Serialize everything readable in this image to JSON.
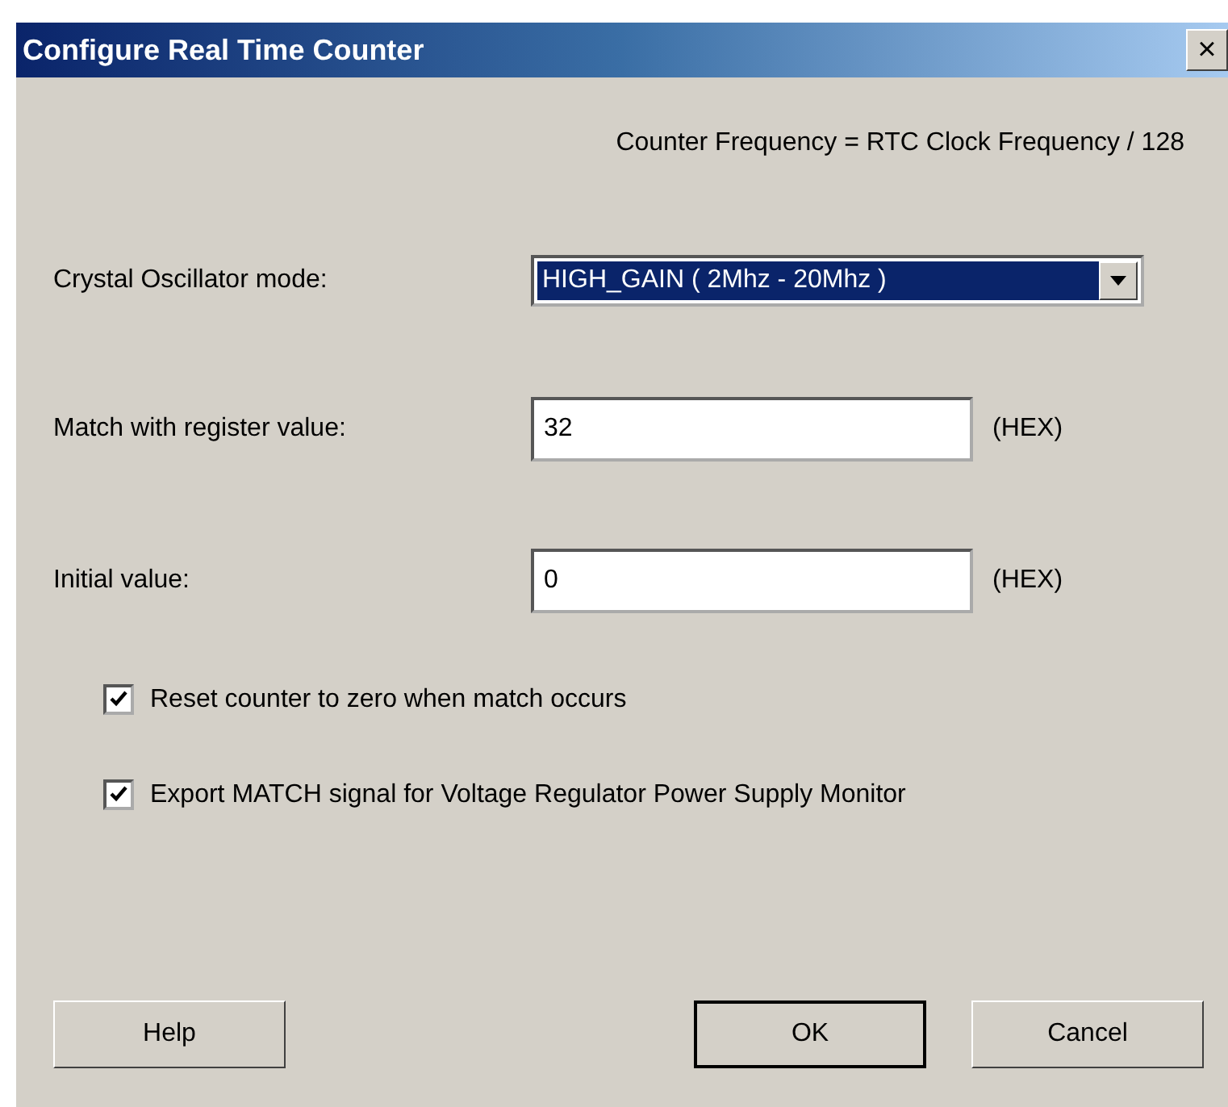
{
  "window": {
    "title": "Configure Real Time Counter",
    "close": "×"
  },
  "formula": "Counter Frequency = RTC Clock Frequency / 128",
  "fields": [
    {
      "kind": "dropdown",
      "label": "Crystal Oscillator mode:",
      "value": "HIGH_GAIN ( 2Mhz - 20Mhz )",
      "focused": true
    },
    {
      "kind": "text",
      "label": "Match with register value:",
      "value": "32",
      "unit": "(HEX)"
    },
    {
      "kind": "text",
      "label": "Initial value:",
      "value": "0",
      "unit": "(HEX)"
    }
  ],
  "checkboxes": [
    {
      "label": "Reset counter to zero when match occurs",
      "checked": true
    },
    {
      "label": "Export MATCH signal for Voltage Regulator Power Supply Monitor",
      "checked": true
    }
  ],
  "buttons": [
    {
      "label": "Help",
      "default": false
    },
    {
      "label": "OK",
      "default": true
    },
    {
      "label": "Cancel",
      "default": false
    }
  ]
}
